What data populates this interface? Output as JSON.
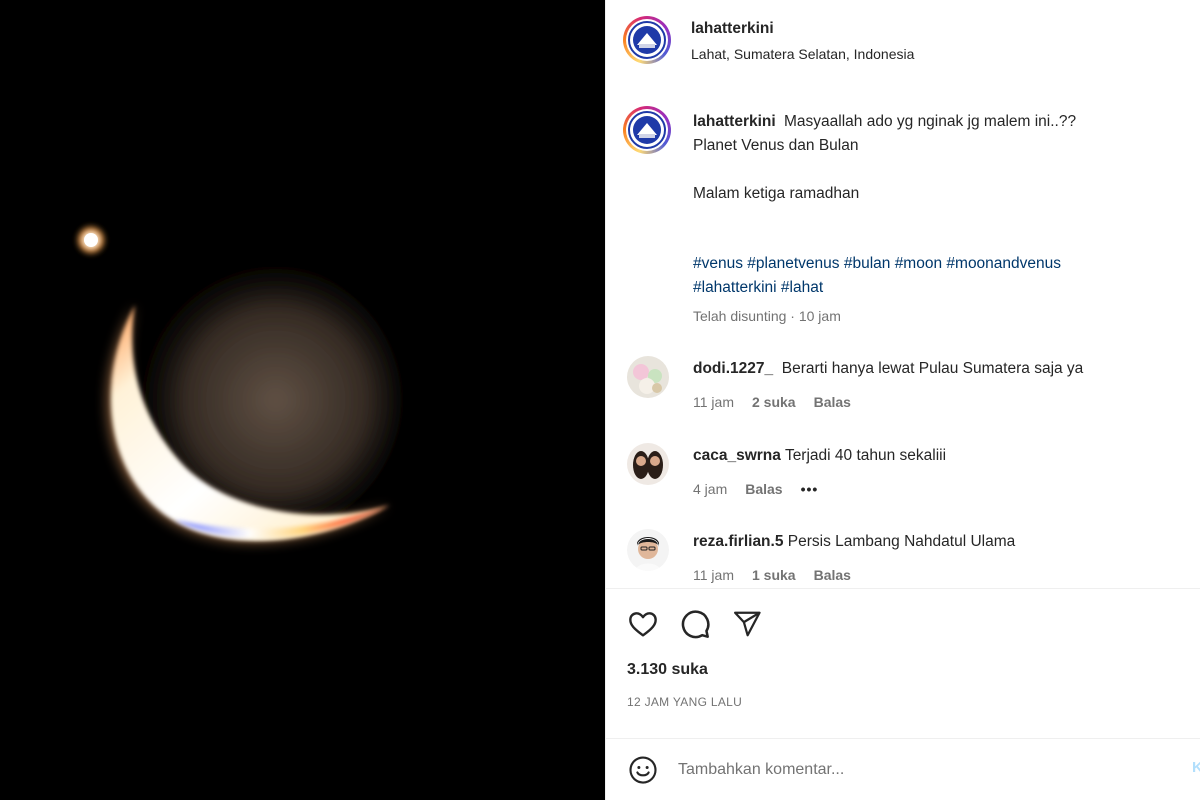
{
  "header": {
    "username": "lahatterkini",
    "location": "Lahat, Sumatera Selatan, Indonesia"
  },
  "caption": {
    "username": "lahatterkini",
    "line1": "Masyaallah ado yg nginak jg malem ini..??",
    "line2": "Planet Venus dan Bulan",
    "line3": "Malam ketiga ramadhan",
    "hashtags_line1": [
      "#venus",
      "#planetvenus",
      "#bulan",
      "#moon",
      "#moonandvenus"
    ],
    "hashtags_line2": [
      "#lahatterkini",
      "#lahat"
    ],
    "edited": "Telah disunting · 10 jam"
  },
  "comments": [
    {
      "username": "dodi.1227_",
      "text": "Berarti hanya lewat Pulau Sumatera saja ya",
      "time": "11 jam",
      "likes": "2 suka",
      "reply": "Balas"
    },
    {
      "username": "caca_swrna",
      "text": "Terjadi 40 tahun sekaliii",
      "time": "4 jam",
      "likes": "",
      "reply": "Balas",
      "more": "•••"
    },
    {
      "username": "reza.firlian.5",
      "text": "Persis Lambang Nahdatul Ulama",
      "time": "11 jam",
      "likes": "1 suka",
      "reply": "Balas"
    }
  ],
  "actions": {
    "like_icon": "heart-icon",
    "comment_icon": "comment-bubble-icon",
    "share_icon": "paper-plane-icon",
    "likes_count": "3.130 suka",
    "posted_time": "12 JAM YANG LALU"
  },
  "comment_box": {
    "emoji_icon": "smiley-icon",
    "placeholder": "Tambahkan komentar...",
    "post_label": "Kirim"
  },
  "colors": {
    "link": "#00376b",
    "muted": "#737373",
    "text": "#262626",
    "photo_bg": "#000000"
  }
}
